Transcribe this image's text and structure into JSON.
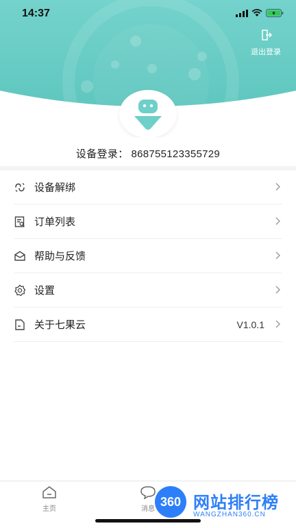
{
  "status_bar": {
    "time": "14:37"
  },
  "header": {
    "logout_label": "退出登录",
    "brand_color": "#6fcfc9",
    "icons": {
      "logout": "logout-icon",
      "avatar": "robot-avatar-icon"
    }
  },
  "device": {
    "label": "设备登录：",
    "value": "868755123355729"
  },
  "menu": {
    "items": [
      {
        "label": "设备解绑",
        "icon": "unbind-icon",
        "extra": ""
      },
      {
        "label": "订单列表",
        "icon": "order-list-icon",
        "extra": ""
      },
      {
        "label": "帮助与反馈",
        "icon": "feedback-icon",
        "extra": ""
      },
      {
        "label": "设置",
        "icon": "gear-icon",
        "extra": ""
      },
      {
        "label": "关于七果云",
        "icon": "about-icon",
        "extra": "V1.0.1"
      }
    ]
  },
  "tabbar": {
    "tabs": [
      {
        "label": "主页",
        "icon": "home-icon"
      },
      {
        "label": "消息",
        "icon": "message-icon"
      }
    ]
  },
  "watermark": {
    "logo_text": "360",
    "title": "网站排行榜",
    "subtitle": "WANGZHAN360.CN"
  }
}
